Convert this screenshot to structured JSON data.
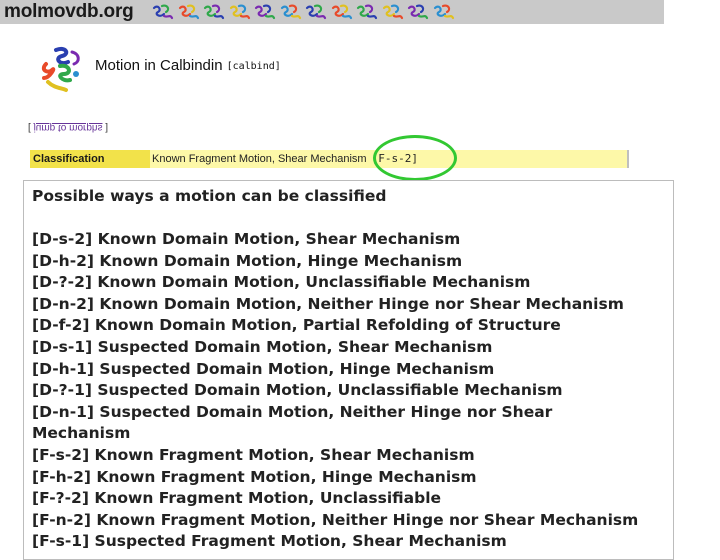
{
  "header": {
    "site_name": "molmovdb.org",
    "nav_icons": [
      "protein-icon",
      "protein-icon",
      "protein-icon",
      "protein-icon",
      "protein-icon",
      "protein-icon",
      "protein-icon",
      "protein-icon",
      "protein-icon",
      "protein-icon",
      "protein-icon",
      "protein-icon"
    ]
  },
  "motion": {
    "title": "Motion in Calbindin",
    "code": "[calbind]",
    "jump_open": "[ ",
    "jump_link": "jump to morphs",
    "jump_close": " ]"
  },
  "classification": {
    "label": "Classification",
    "value": "Known Fragment Motion, Shear Mechanism",
    "code": "[F-s-2]",
    "highlight_color": "#32c832"
  },
  "popup": {
    "title": "Possible ways a motion can be classified",
    "items": [
      "[D-s-2] Known Domain Motion, Shear Mechanism",
      "[D-h-2] Known Domain Motion, Hinge Mechanism",
      "[D-?-2] Known Domain Motion, Unclassifiable Mechanism",
      "[D-n-2] Known Domain Motion, Neither Hinge nor Shear Mechanism",
      "[D-f-2] Known Domain Motion, Partial Refolding of Structure",
      "[D-s-1] Suspected Domain Motion, Shear Mechanism",
      "[D-h-1] Suspected Domain Motion, Hinge Mechanism",
      "[D-?-1] Suspected Domain Motion, Unclassifiable Mechanism",
      "[D-n-1] Suspected Domain Motion, Neither Hinge nor Shear",
      "Mechanism",
      "[F-s-2] Known Fragment Motion, Shear Mechanism",
      "[F-h-2] Known Fragment Motion, Hinge Mechanism",
      "[F-?-2] Known Fragment Motion, Unclassifiable",
      "[F-n-2] Known Fragment Motion, Neither Hinge nor Shear Mechanism",
      "[F-s-1] Suspected Fragment Motion, Shear Mechanism"
    ]
  }
}
